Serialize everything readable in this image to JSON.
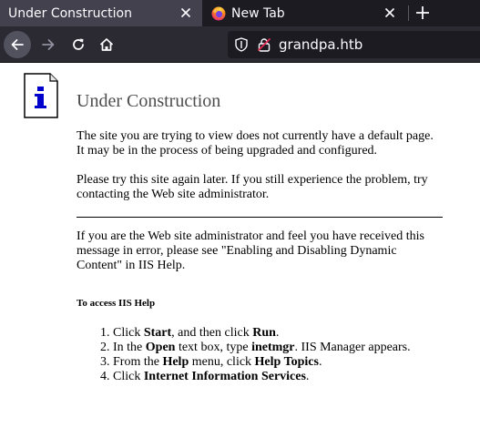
{
  "browser": {
    "tabs": [
      {
        "title": "Under Construction",
        "active": true
      },
      {
        "title": "New Tab",
        "active": false
      }
    ],
    "url": "grandpa.htb",
    "icons": [
      "back-arrow-icon",
      "forward-arrow-icon",
      "reload-icon",
      "home-icon",
      "shield-icon",
      "insecure-lock-icon",
      "close-icon",
      "plus-icon",
      "firefox-icon"
    ],
    "colors": {
      "tabbar": "#1c1b22",
      "active_tab": "#42414d",
      "navbar": "#2b2a33",
      "urlbar": "#1c1b22"
    }
  },
  "page": {
    "title": "Under Construction",
    "para1": "The site you are trying to view does not currently have a default page. It may be in the process of being upgraded and configured.",
    "para2": "Please try this site again later. If you still experience the problem, try contacting the Web site administrator.",
    "para3": "If you are the Web site administrator and feel you have received this message in error, please see \"Enabling and Disabling Dynamic Content\" in IIS Help.",
    "help_heading": "To access IIS Help",
    "steps": [
      {
        "a": "Click ",
        "b": "Start",
        "c": ", and then click ",
        "d": "Run",
        "e": "."
      },
      {
        "a": "In the ",
        "b": "Open",
        "c": " text box, type ",
        "d": "inetmgr",
        "e": ". IIS Manager appears."
      },
      {
        "a": "From the ",
        "b": "Help",
        "c": " menu, click ",
        "d": "Help Topics",
        "e": "."
      },
      {
        "a": "Click ",
        "b": "Internet Information Services",
        "c": ".",
        "d": "",
        "e": ""
      }
    ],
    "info_icon_letter": "i"
  }
}
